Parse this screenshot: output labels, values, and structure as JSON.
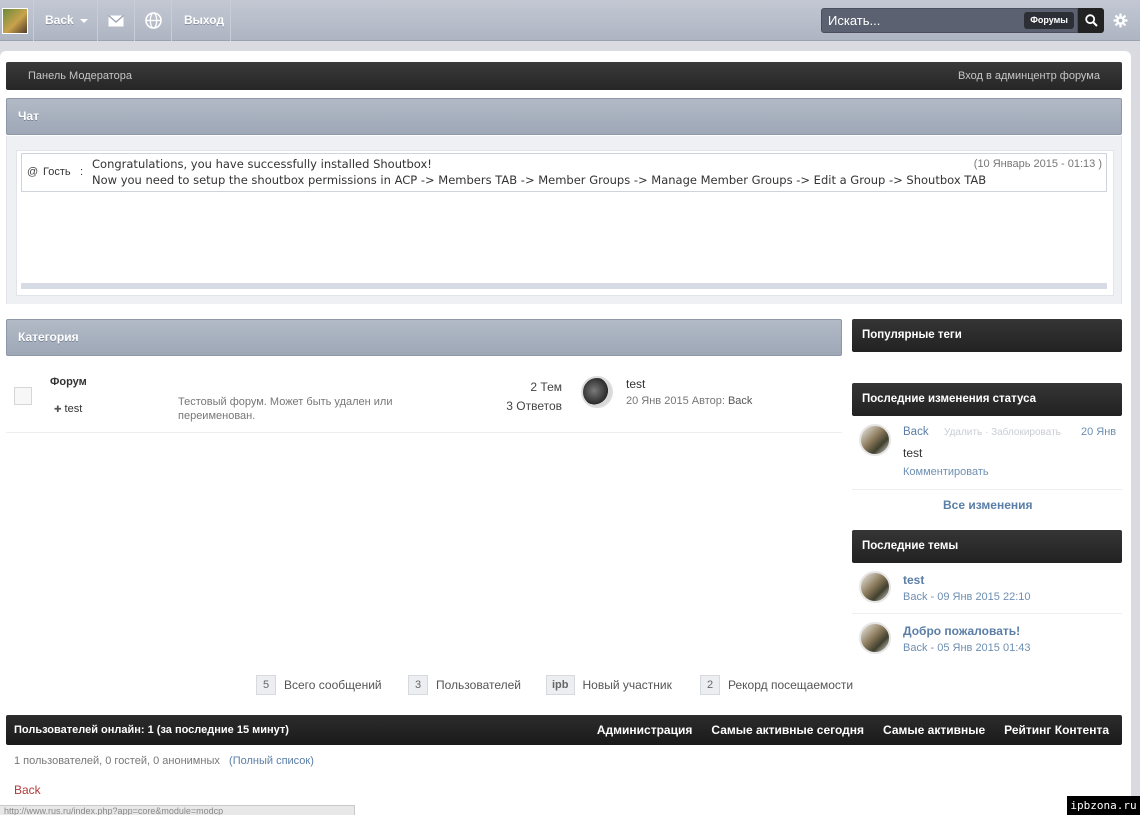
{
  "topbar": {
    "user_name": "Back",
    "logout_label": "Выход",
    "search_placeholder": "Искать...",
    "search_scope": "Форумы"
  },
  "modbar": {
    "left_label": "Панель Модератора",
    "right_label": "Вход в админцентр форума"
  },
  "chat": {
    "title": "Чат",
    "message": {
      "at": "@",
      "author": "Гость",
      "separator": ":",
      "line1": "Congratulations, you have successfully installed Shoutbox!",
      "line2": "Now you need to setup the shoutbox permissions in ACP -> Members TAB -> Member Groups -> Manage Member Groups -> Edit a Group -> Shoutbox TAB",
      "time": "(10 Январь 2015 - 01:13 )"
    }
  },
  "category": {
    "title": "Категория",
    "forum": {
      "title": "Форум",
      "subforum": "test",
      "subforum_bullet": "✚",
      "description": "Тестовый форум. Может быть удален или переименован.",
      "topics": "2 Тем",
      "replies": "3 Ответов",
      "last_title": "test",
      "last_date": "20 Янв 2015",
      "last_author_label": "Автор:",
      "last_author": "Back"
    }
  },
  "sidebar": {
    "tags_title": "Популярные теги",
    "status_title": "Последние изменения статуса",
    "status": {
      "user": "Back",
      "actions": "Удалить · Заблокировать",
      "date": "20 Янв",
      "text": "test",
      "comment": "Комментировать",
      "all_changes": "Все изменения"
    },
    "topics_title": "Последние темы",
    "topics": [
      {
        "title": "test",
        "meta": "Back - 09 Янв 2015 22:10"
      },
      {
        "title": "Добро пожаловать!",
        "meta": "Back - 05 Янв 2015 01:43"
      }
    ]
  },
  "stats": [
    {
      "value": "5",
      "label": "Всего сообщений"
    },
    {
      "value": "3",
      "label": "Пользователей"
    },
    {
      "value": "ipb",
      "label": "Новый участник"
    },
    {
      "value": "2",
      "label": "Рекорд посещаемости"
    }
  ],
  "online": {
    "title": "Пользователей онлайн: 1 (за последние 15 минут)",
    "links": [
      "Администрация",
      "Самые активные сегодня",
      "Самые активные",
      "Рейтинг Контента"
    ],
    "summary": "1 пользователей, 0 гостей, 0 анонимных",
    "full_list": "(Полный список)",
    "user": "Back"
  },
  "status_bar": {
    "url": "http://www.rus.ru/index.php?app=core&module=modcp"
  },
  "watermark": "ipbzona.ru",
  "colors": {
    "accent": "#5a7ea6",
    "dark_header": "#222222",
    "category_header": "#a3acba",
    "online_user": "#b23a3a"
  }
}
